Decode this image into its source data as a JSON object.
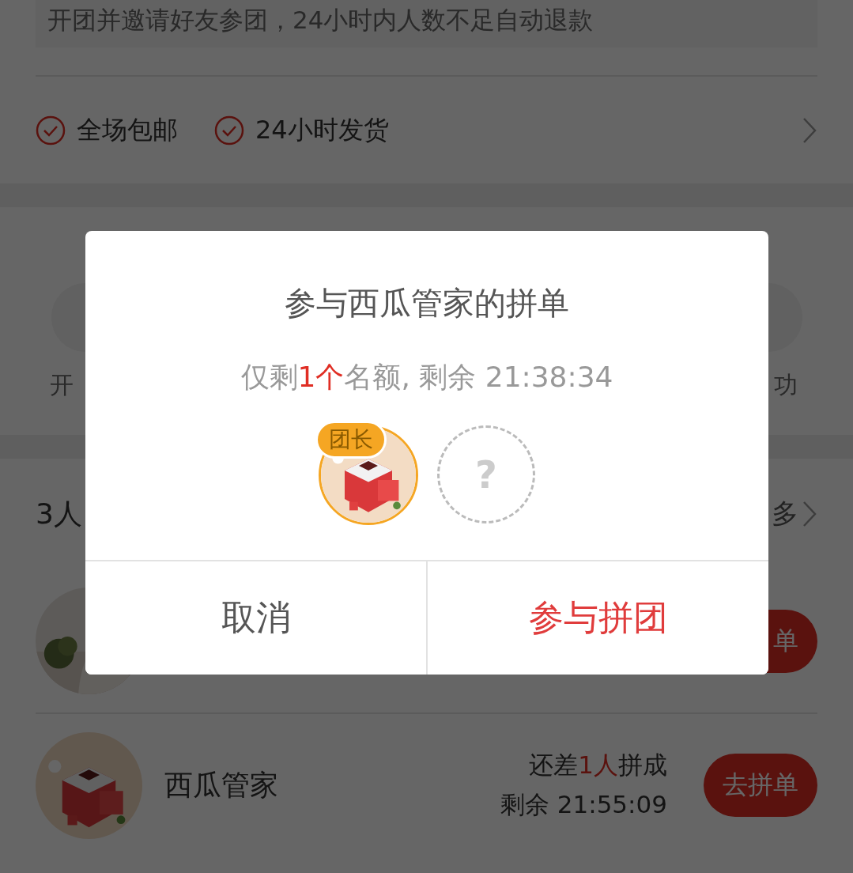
{
  "page": {
    "rule_text": "开团并邀请好友参团，24小时内人数不足自动退款",
    "services": [
      {
        "label": "全场包邮"
      },
      {
        "label": "24小时发货"
      }
    ],
    "steps": {
      "left_label": "开",
      "right_label": "功"
    },
    "groups": {
      "title": "3人",
      "more": "多",
      "rows": [
        {
          "button": "单"
        },
        {
          "kind": "mascot",
          "name": "西瓜管家",
          "need": {
            "before": "还差",
            "highlight": "1人",
            "after": "拼成"
          },
          "remaining": "剩余 21:55:09",
          "button": "去拼单"
        }
      ]
    }
  },
  "dialog": {
    "title": "参与西瓜管家的拼单",
    "subtitle": {
      "before": "仅剩",
      "highlight": "1个",
      "after": "名额, 剩余 21:38:34"
    },
    "members": [
      {
        "kind": "leader",
        "badge": "团长"
      },
      {
        "kind": "empty",
        "mark": "?"
      }
    ],
    "buttons": [
      {
        "label": "取消",
        "kind": "cancel"
      },
      {
        "label": "参与拼团",
        "kind": "confirm"
      }
    ]
  }
}
